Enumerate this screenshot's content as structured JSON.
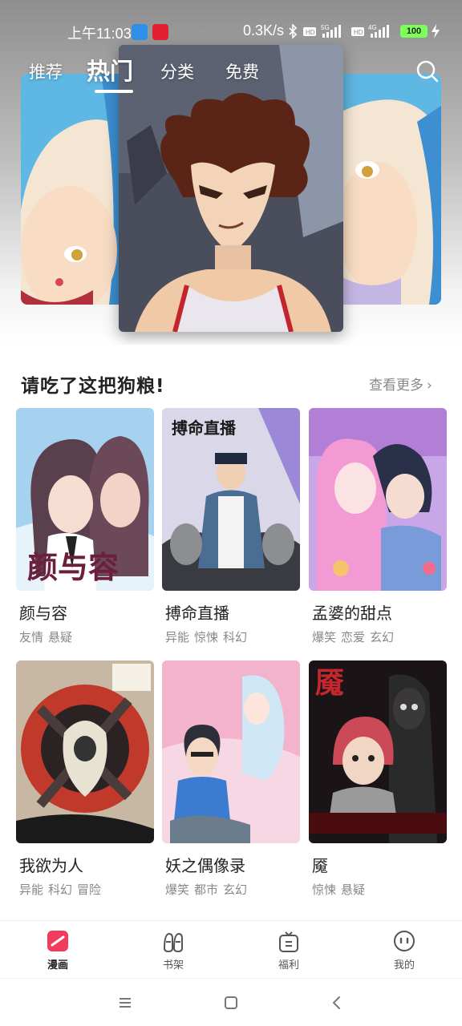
{
  "status_bar": {
    "time": "上午11:03",
    "net_speed": "0.3K/s",
    "sim1": "5G",
    "sim2": "4G",
    "battery": "100"
  },
  "top_tabs": [
    {
      "label": "推荐",
      "active": false
    },
    {
      "label": "热门",
      "active": true
    },
    {
      "label": "分类",
      "active": false
    },
    {
      "label": "免费",
      "active": false
    }
  ],
  "section": {
    "title": "请吃了这把狗粮!",
    "more_label": "查看更多"
  },
  "comics": [
    {
      "title": "颜与容",
      "tags": [
        "友情",
        "悬疑"
      ],
      "cover_text": "颜与容"
    },
    {
      "title": "搏命直播",
      "tags": [
        "异能",
        "惊悚",
        "科幻"
      ],
      "cover_text": "搏命直播"
    },
    {
      "title": "孟婆的甜点",
      "tags": [
        "爆笑",
        "恋爱",
        "玄幻"
      ],
      "cover_text": ""
    },
    {
      "title": "我欲为人",
      "tags": [
        "异能",
        "科幻",
        "冒险"
      ],
      "cover_text": ""
    },
    {
      "title": "妖之偶像录",
      "tags": [
        "爆笑",
        "都市",
        "玄幻"
      ],
      "cover_text": ""
    },
    {
      "title": "魇",
      "tags": [
        "惊悚",
        "悬疑"
      ],
      "cover_text": "魇"
    }
  ],
  "bottom_nav": [
    {
      "label": "漫画",
      "icon": "comic-icon",
      "active": true
    },
    {
      "label": "书架",
      "icon": "bookshelf-icon",
      "active": false
    },
    {
      "label": "福利",
      "icon": "gift-icon",
      "active": false
    },
    {
      "label": "我的",
      "icon": "profile-icon",
      "active": false
    }
  ],
  "colors": {
    "accent": "#f23c5c",
    "text_primary": "#222222",
    "text_secondary": "#888888"
  }
}
